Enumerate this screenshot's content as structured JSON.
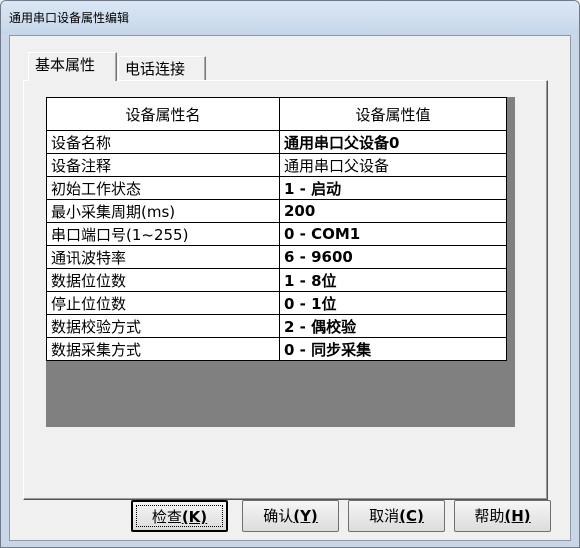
{
  "window": {
    "title": "通用串口设备属性编辑"
  },
  "tabs": [
    {
      "label": "基本属性"
    },
    {
      "label": "电话连接"
    }
  ],
  "table": {
    "headers": [
      "设备属性名",
      "设备属性值"
    ],
    "rows": [
      [
        "设备名称",
        "通用串口父设备0"
      ],
      [
        "设备注释",
        "通用串口父设备"
      ],
      [
        "初始工作状态",
        "1 - 启动"
      ],
      [
        "最小采集周期(ms)",
        "200"
      ],
      [
        "串口端口号(1~255)",
        "0 - COM1"
      ],
      [
        "通讯波特率",
        "6 - 9600"
      ],
      [
        "数据位位数",
        "1 - 8位"
      ],
      [
        "停止位位数",
        "0 - 1位"
      ],
      [
        "数据校验方式",
        "2 - 偶校验"
      ],
      [
        "数据采集方式",
        "0 - 同步采集"
      ]
    ]
  },
  "buttons": {
    "check": {
      "label": "检查",
      "mnemonic": "(K)"
    },
    "ok": {
      "label": "确认",
      "mnemonic": "(Y)"
    },
    "cancel": {
      "label": "取消",
      "mnemonic": "(C)"
    },
    "help": {
      "label": "帮助",
      "mnemonic": "(H)"
    }
  }
}
